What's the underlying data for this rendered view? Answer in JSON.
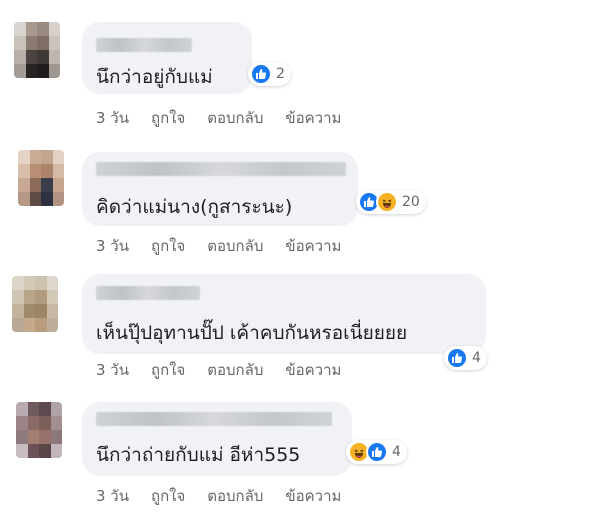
{
  "comments": [
    {
      "text": "นึกว่าอยู่กับแม่",
      "reaction_icons": [
        "like-icon"
      ],
      "reaction_count": "2",
      "time": "3 วัน",
      "like_label": "ถูกใจ",
      "reply_label": "ตอบกลับ",
      "message_label": "ข้อความ"
    },
    {
      "text": "คิดว่าแม่นาง(กูสาระนะ)",
      "reaction_icons": [
        "like-icon",
        "haha-icon"
      ],
      "reaction_count": "20",
      "time": "3 วัน",
      "like_label": "ถูกใจ",
      "reply_label": "ตอบกลับ",
      "message_label": "ข้อความ"
    },
    {
      "text": "เห็นปุ๊ปอุทานปั๊ป เค้าคบกันหรอเนี่ยยยย",
      "reaction_icons": [
        "like-icon"
      ],
      "reaction_count": "4",
      "time": "3 วัน",
      "like_label": "ถูกใจ",
      "reply_label": "ตอบกลับ",
      "message_label": "ข้อความ"
    },
    {
      "text": "นึกว่าถ่ายกับแม่ อีห่า555",
      "reaction_icons": [
        "haha-icon",
        "like-icon"
      ],
      "reaction_count": "4",
      "time": "3 วัน",
      "like_label": "ถูกใจ",
      "reply_label": "ตอบกลับ",
      "message_label": "ข้อความ"
    }
  ],
  "colors": {
    "bubble": "#f0f2f5",
    "text": "#1c1e21",
    "meta": "#65676b",
    "like": "#1877f2",
    "haha": "#f7b125"
  }
}
